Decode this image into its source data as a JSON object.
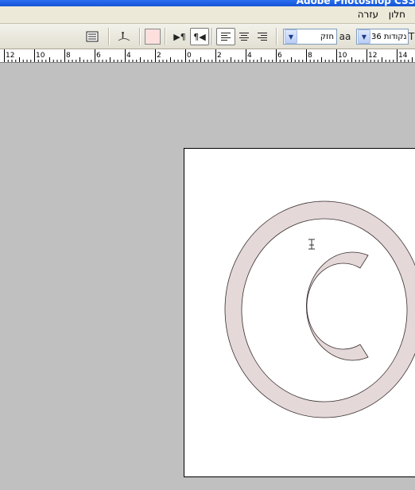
{
  "window": {
    "title": "Adobe Photoshop CS3"
  },
  "menubar": {
    "items": [
      {
        "label": "חלון"
      },
      {
        "label": "עזרה"
      }
    ]
  },
  "options": {
    "font_size": "36 נקודות",
    "font_style": "חזק",
    "aa_label": "aa",
    "text_color": "#fde0de",
    "align": "left"
  },
  "ruler": {
    "labels": [
      "12",
      "10",
      "8",
      "6",
      "4",
      "2",
      "0",
      "2",
      "4",
      "6",
      "8",
      "10",
      "12",
      "14"
    ]
  },
  "document": {
    "shape": "copyright-symbol",
    "fill": "#e4d8d8",
    "stroke": "#3a2f2f"
  },
  "colors": {
    "workspace": "#c0c0c0",
    "menubar": "#ece9d8",
    "title_blue": "#1454d6"
  }
}
